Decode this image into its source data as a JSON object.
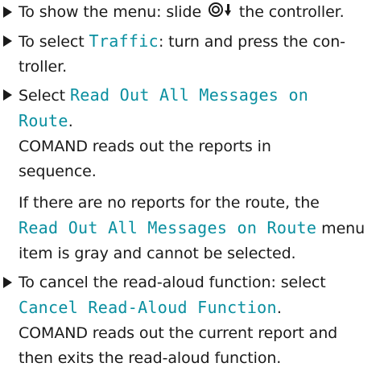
{
  "step1": {
    "before": "To show the menu: slide ",
    "icon": "controller-slide-down-icon",
    "after": " the controller."
  },
  "step2": {
    "before": "To select ",
    "code": "Traffic",
    "after_line1": ": turn and press the con-",
    "after_line2": "troller."
  },
  "step3": {
    "before": "Select ",
    "code_line1": "Read Out All Messages on",
    "code_line2": "Route",
    "after": ".",
    "result_line1": "COMAND reads out the reports in",
    "result_line2": "sequence."
  },
  "note": {
    "line1": "If there are no reports for the route, the",
    "code": "Read Out All Messages on Route",
    "after_code": " menu",
    "line3": "item is gray and cannot be selected."
  },
  "step4": {
    "line1": "To cancel the read-aloud function: select",
    "code": "Cancel Read-Aloud Function",
    "after_code": ".",
    "result_line1": "COMAND reads out the current report and",
    "result_line2": "then exits the read-aloud function."
  },
  "colors": {
    "text": "#1a1a1a",
    "menu_item": "#0a8fa0"
  }
}
